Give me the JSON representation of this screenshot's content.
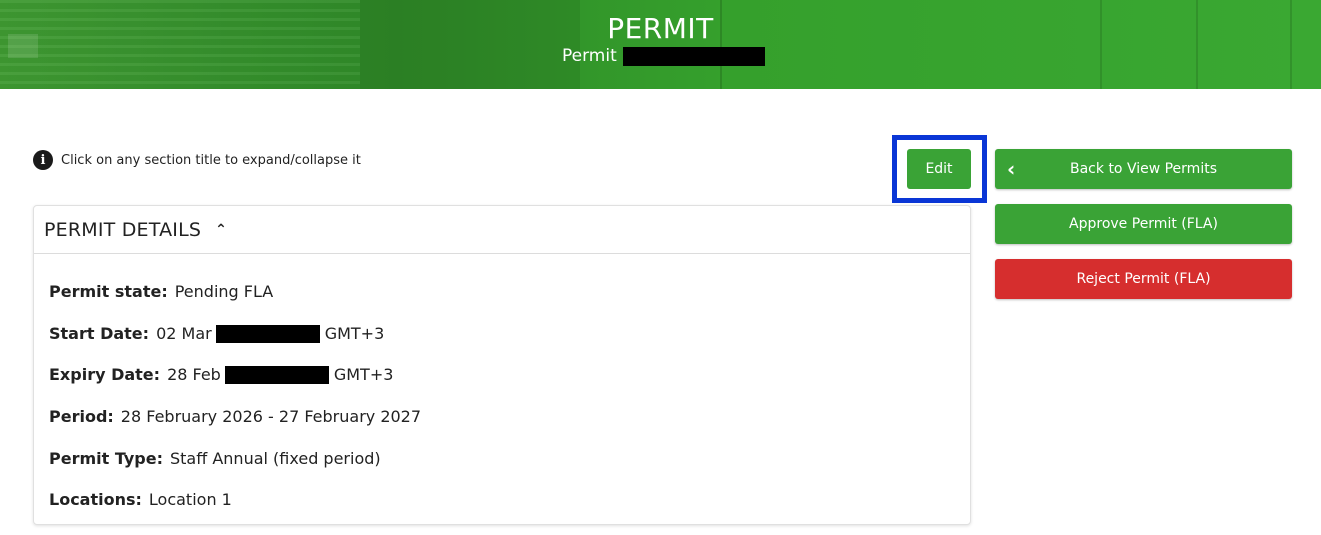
{
  "header": {
    "title": "PERMIT",
    "subtitle": "Permit"
  },
  "hint": {
    "icon": "info-icon",
    "text": "Click on any section title to expand/collapse it"
  },
  "actions": {
    "edit_label": "Edit",
    "back_label": "Back to View Permits",
    "approve_label": "Approve Permit (FLA)",
    "reject_label": "Reject Permit (FLA)"
  },
  "colors": {
    "primary_green": "#3aa336",
    "reject_red": "#d62e2e",
    "highlight_blue": "#0a36d6"
  },
  "details": {
    "section_title": "PERMIT DETAILS",
    "state": {
      "label": "Permit state:",
      "value": "Pending FLA"
    },
    "start": {
      "label": "Start Date:",
      "prefix": "02 Mar",
      "suffix": "GMT+3"
    },
    "expiry": {
      "label": "Expiry Date:",
      "prefix": "28 Feb",
      "suffix": "GMT+3"
    },
    "period": {
      "label": "Period:",
      "value": "28 February 2026 - 27 February 2027"
    },
    "type": {
      "label": "Permit Type:",
      "value": "Staff Annual (fixed period)"
    },
    "locations": {
      "label": "Locations:",
      "value": "Location 1"
    }
  }
}
